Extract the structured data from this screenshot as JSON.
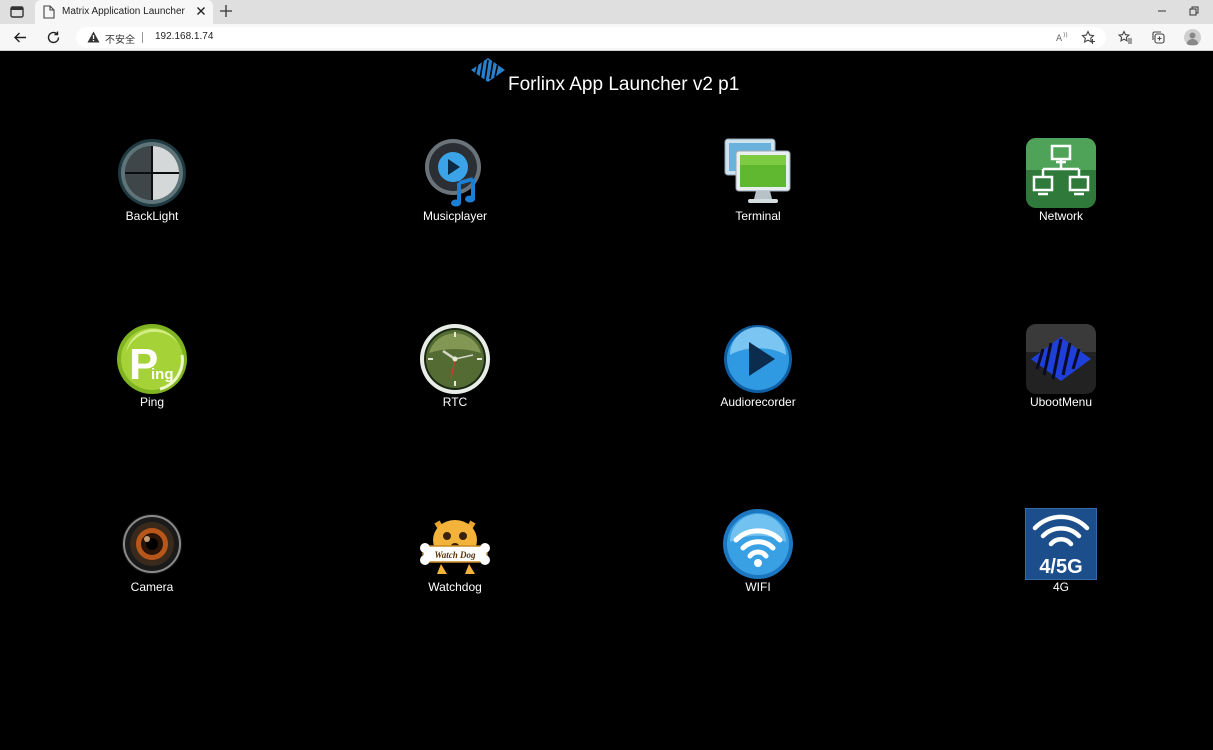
{
  "browser": {
    "tab_title": "Matrix Application Launcher",
    "security_label": "不安全",
    "url": "192.168.1.74"
  },
  "page": {
    "title": "Forlinx App Launcher v2 p1"
  },
  "apps": [
    {
      "label": "BackLight",
      "icon": "backlight-icon"
    },
    {
      "label": "Musicplayer",
      "icon": "music-player-icon"
    },
    {
      "label": "Terminal",
      "icon": "terminal-icon"
    },
    {
      "label": "Network",
      "icon": "network-icon"
    },
    {
      "label": "Ping",
      "icon": "ping-icon",
      "icon_text_big": "P",
      "icon_text_small": "ing"
    },
    {
      "label": "RTC",
      "icon": "clock-icon"
    },
    {
      "label": "Audiorecorder",
      "icon": "play-icon"
    },
    {
      "label": "UbootMenu",
      "icon": "uboot-logo-icon"
    },
    {
      "label": "Camera",
      "icon": "camera-icon"
    },
    {
      "label": "Watchdog",
      "icon": "watchdog-icon",
      "icon_text": "Watch Dog"
    },
    {
      "label": "WIFI",
      "icon": "wifi-icon"
    },
    {
      "label": "4G",
      "icon": "4g-signal-icon",
      "icon_text": "4/5G"
    }
  ]
}
